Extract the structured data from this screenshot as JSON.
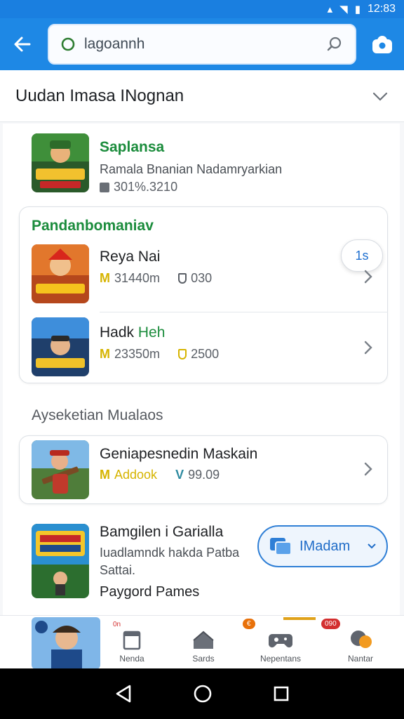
{
  "status_bar": {
    "time": "12:83"
  },
  "search": {
    "query": "lagoannh"
  },
  "section": {
    "title": "Uudan Imasa INognan"
  },
  "featured": {
    "title": "Saplansa",
    "subtitle": "Ramala Bnanian Nadamryarkian",
    "meta": "301%.3210"
  },
  "card1": {
    "heading": "Pandanbomaniav",
    "badge": "1s",
    "items": [
      {
        "title": "Reya Nai",
        "stat1": "31440m",
        "stat2": "030"
      },
      {
        "title": "Hadk",
        "title_accent": "Heh",
        "stat1": "23350m",
        "stat2": "2500"
      }
    ]
  },
  "group2": {
    "title": "Ayseketian Mualaos",
    "item": {
      "title": "Geniapesnedin Maskain",
      "stat1": "Addook",
      "stat2": "99.09"
    }
  },
  "promo": {
    "title": "Bamgilen i Garialla",
    "desc_line1": "Iuadlamndk hakda Patba",
    "desc_line2": "Sattai.",
    "tagline": "Paygord Pames",
    "button_label": "IMadam"
  },
  "bottom_nav": {
    "items": [
      {
        "label": "",
        "icon": "game-thumbnail"
      },
      {
        "label": "Nenda",
        "icon": "bookmark-icon",
        "badge": "0n"
      },
      {
        "label": "Sards",
        "icon": "home-icon"
      },
      {
        "label": "Nepentans",
        "icon": "controller-icon",
        "badge": "€"
      },
      {
        "label": "Nantar",
        "icon": "chat-icon",
        "badge": "090"
      }
    ]
  },
  "colors": {
    "primary": "#1e88e5",
    "accent_green": "#1b8c3c",
    "accent_yellow": "#d6b400"
  }
}
